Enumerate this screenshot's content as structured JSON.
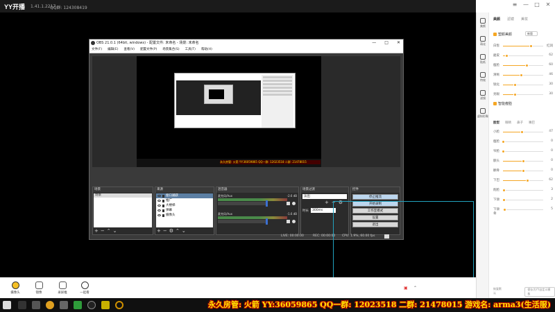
{
  "yy": {
    "logo": "YY开播",
    "version": "1.41.1.2217",
    "qq": "QQ群: 124308419",
    "controls": [
      "≡",
      "—",
      "□",
      "✕"
    ]
  },
  "right_panel": {
    "tabs": [
      "美颜",
      "滤镜",
      "美妆"
    ],
    "tools": [
      "美颜",
      "萌化",
      "贴纸",
      "特效",
      "滤镜",
      "虚拟形象"
    ],
    "section1": "塑颜美颜",
    "section1_select": "新版",
    "sliders1": [
      {
        "label": "白皙",
        "value": "红润",
        "fill": 0.7
      },
      {
        "label": "磨皮",
        "value": "62",
        "fill": 0.1
      },
      {
        "label": "瘦脸",
        "value": "60",
        "fill": 0.6
      },
      {
        "label": "清晰",
        "value": "46",
        "fill": 0.45
      },
      {
        "label": "锐化",
        "value": "30",
        "fill": 0.3
      },
      {
        "label": "亮眼",
        "value": "30",
        "fill": 0.3
      }
    ],
    "section2": "智能瘦脸",
    "sub_tabs": [
      "脸型",
      "眼睛",
      "鼻子",
      "嘴巴"
    ],
    "sliders2": [
      {
        "label": "小脸",
        "value": "47",
        "fill": 0.47
      },
      {
        "label": "瘦脸",
        "value": "0",
        "fill": 0.0
      },
      {
        "label": "窄脸",
        "value": "0",
        "fill": 0.0
      },
      {
        "label": "额头",
        "value": "0",
        "fill": 0.5
      },
      {
        "label": "颧骨",
        "value": "0",
        "fill": 0.5
      },
      {
        "label": "下巴",
        "value": "62",
        "fill": 0.62
      },
      {
        "label": "削脸",
        "value": "3",
        "fill": 0.03
      },
      {
        "label": "下颌",
        "value": "2",
        "fill": 0.02
      },
      {
        "label": "下颌骨",
        "value": "5",
        "fill": 0.05
      }
    ],
    "footer_left": "恢复默认",
    "footer_right": "保存为YY自定义模板"
  },
  "obs": {
    "title": "OBS 21.0.1 (64bit, windows) - 配置文件: 未命名 - 场景: 未命名",
    "controls": [
      "—",
      "□",
      "✕"
    ],
    "menu": [
      "文件(F)",
      "编辑(E)",
      "查看(V)",
      "配置文件(P)",
      "场景集合(S)",
      "工具(T)",
      "帮助(H)"
    ],
    "ticker": "永久房管: 火箭 YY:36059865 QQ一群: 12023518 二群: 21478015",
    "panels": {
      "scenes": {
        "header": "场景",
        "items": [
          "场景"
        ]
      },
      "sources": {
        "header": "来源",
        "items": [
          "窗口捕获",
          "推广",
          "大楼梯",
          "弹幕",
          "摄像头"
        ]
      },
      "mixer": {
        "header": "混音器",
        "rows": [
          {
            "name": "麦克风/Aux",
            "db": "-2.6 dB"
          },
          {
            "name": "麦克风/Aux",
            "db": "-1.6 dB"
          }
        ]
      },
      "transitions": {
        "header": "场景过渡",
        "select": "淡出",
        "duration_label": "时长",
        "duration": "300ms"
      },
      "controls": {
        "header": "控件",
        "buttons": [
          "停止推流",
          "开始录制",
          "工作室模式",
          "设置",
          "退出"
        ]
      }
    },
    "status": {
      "live": "LIVE: 00:00:00",
      "rec": "REC: 00:00:00",
      "cpu": "CPU: 1.9%, 60.00 fps"
    }
  },
  "bottom_toolbar": {
    "items": [
      "摄像头",
      "镜像",
      "录屏推",
      "一起看"
    ],
    "right_icon": "camera-icon"
  },
  "taskbar": {
    "marquee": "永久房管: 火箭 YY:36059865 QQ一群: 12023518 二群: 21478015 游戏名: arma3(生活服)"
  },
  "colors": {
    "accent": "#f5a623",
    "selection": "#22a3c0",
    "marquee_fill": "#ffe400",
    "marquee_outline": "#b00000"
  }
}
